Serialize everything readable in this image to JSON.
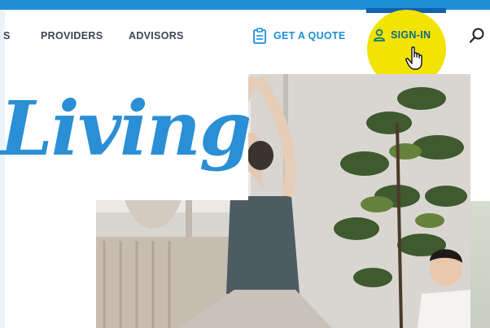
{
  "nav": {
    "clipped_item": "S",
    "providers": "PROVIDERS",
    "advisors": "ADVISORS",
    "quote": "GET A QUOTE",
    "signin": "SIGN-IN"
  },
  "hero": {
    "word": "Living"
  },
  "icons": {
    "quote": "clipboard-icon",
    "signin": "user-icon",
    "search": "search-icon",
    "cursor": "hand-pointer-icon"
  },
  "colors": {
    "brand_blue": "#1e8fd6",
    "highlight": "#f2e300",
    "signin_text": "#0c6a8f"
  }
}
